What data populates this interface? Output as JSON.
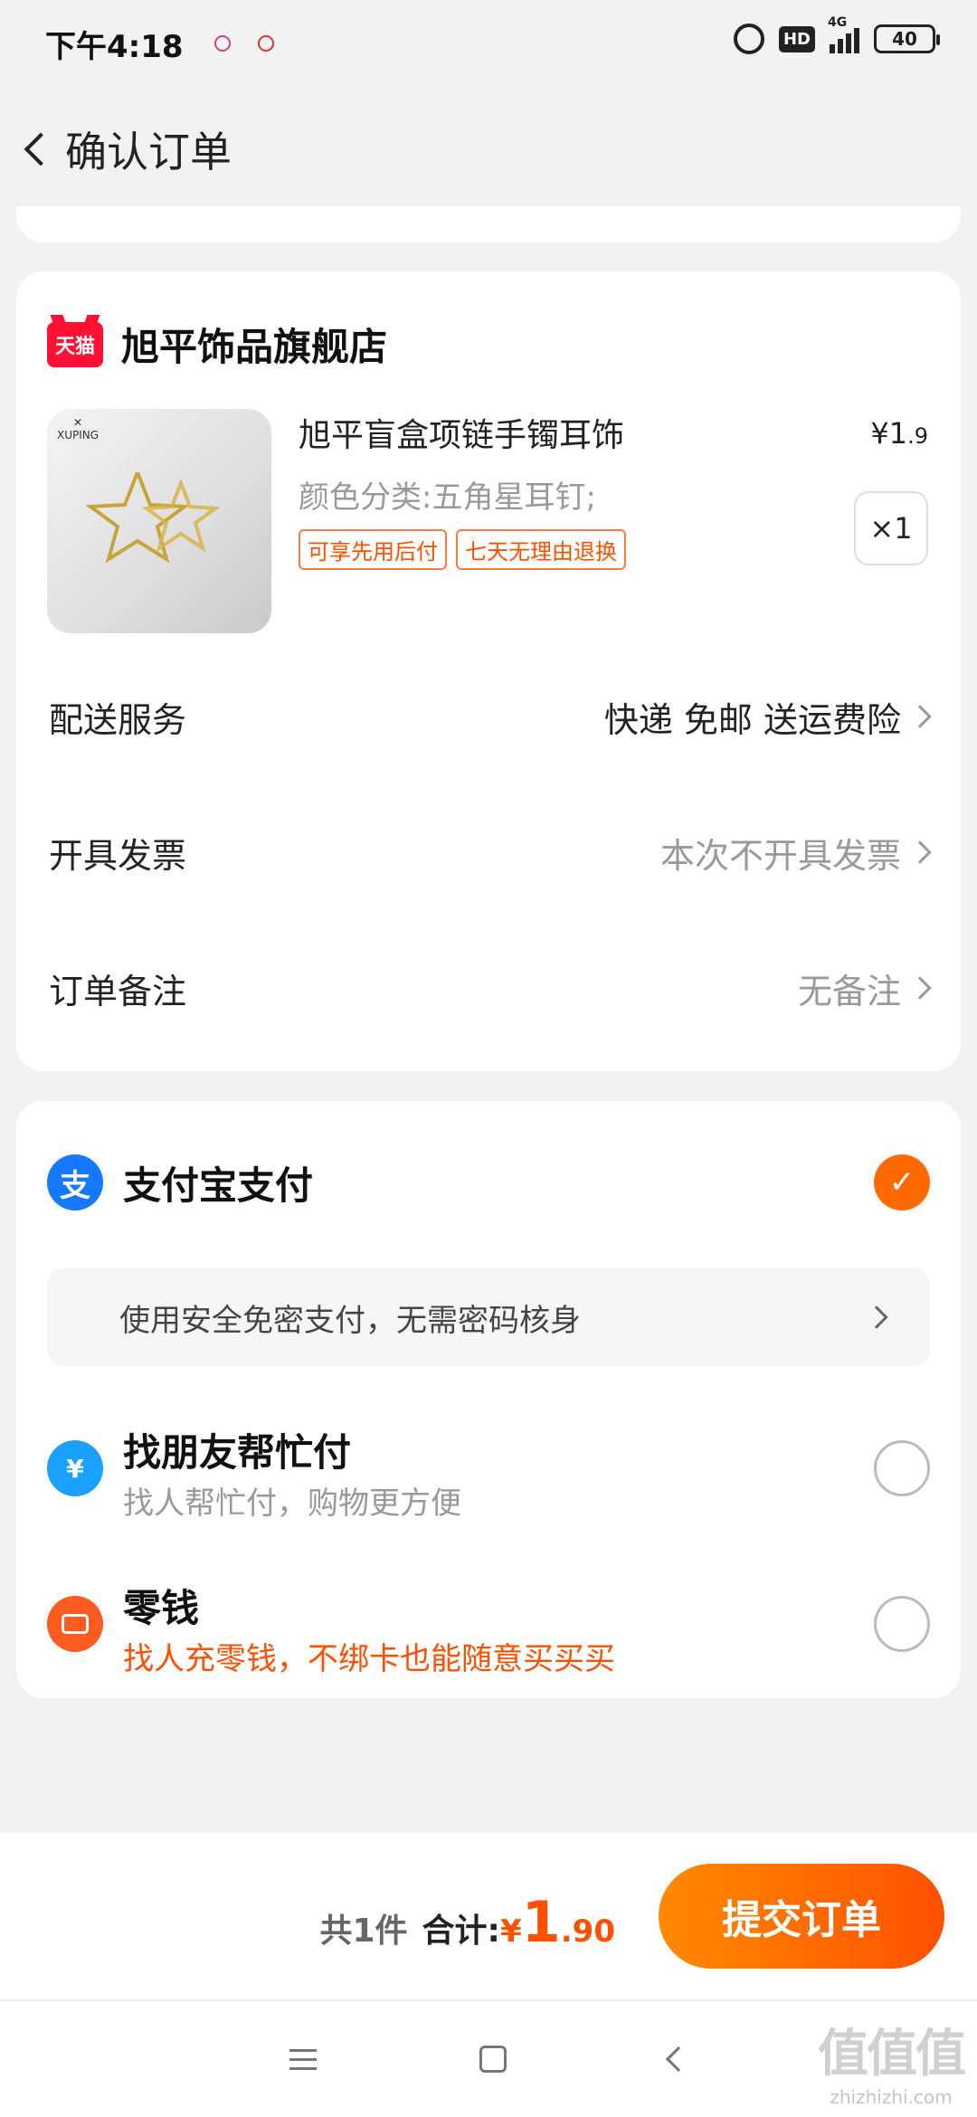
{
  "status": {
    "time": "下午4:18",
    "hd": "HD",
    "net": "4G",
    "battery": "40"
  },
  "nav": {
    "title": "确认订单"
  },
  "shop": {
    "badge": "天猫",
    "name": "旭平饰品旗舰店"
  },
  "product": {
    "image_brand": "XUPING",
    "title": "旭平盲盒项链手镯耳饰",
    "price_symbol": "¥",
    "price_int": "1",
    "price_dec": ".9",
    "sku": "颜色分类:五角星耳钉;",
    "tags": [
      "可享先用后付",
      "七天无理由退换"
    ],
    "quantity": "×1"
  },
  "rows": [
    {
      "label": "配送服务",
      "value": "快递 免邮 送运费险"
    },
    {
      "label": "开具发票",
      "value": "本次不开具发票"
    },
    {
      "label": "订单备注",
      "value": "无备注"
    }
  ],
  "payment": {
    "alipay": {
      "icon": "支",
      "name": "支付宝支付",
      "checkmark": "✓"
    },
    "promo": "使用安全免密支付，无需密码核身",
    "friend": {
      "icon": "¥",
      "title": "找朋友帮忙付",
      "subtitle": "找人帮忙付，购物更方便"
    },
    "change": {
      "title": "零钱",
      "subtitle": "找人充零钱，不绑卡也能随意买买买"
    }
  },
  "footer": {
    "count": "共1件",
    "total_label": "合计:",
    "total_symbol": "¥",
    "total_int": "1",
    "total_dec": ".90",
    "submit": "提交订单"
  },
  "watermark": {
    "big": "值值值",
    "small": "zhizhizhi.com"
  },
  "colors": {
    "accent": "#ff5000",
    "alipay": "#1677ff",
    "tmall": "#ff1133"
  }
}
